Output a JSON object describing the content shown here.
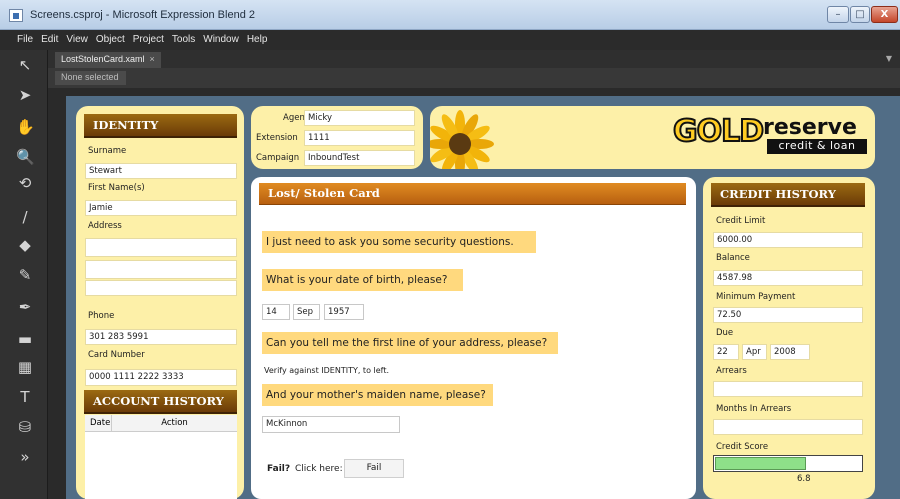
{
  "window": {
    "title": "Screens.csproj - Microsoft Expression Blend 2",
    "buttons": {
      "minimize": "–",
      "maximize": "□",
      "close": "X"
    }
  },
  "menu": [
    "File",
    "Edit",
    "View",
    "Object",
    "Project",
    "Tools",
    "Window",
    "Help"
  ],
  "document_tab": {
    "label": "LostStolenCard.xaml",
    "close": "×"
  },
  "selection_label": "None selected",
  "tools": [
    {
      "name": "selection-tool-icon",
      "glyph": "↖"
    },
    {
      "name": "direct-selection-tool-icon",
      "glyph": "➤"
    },
    {
      "name": "pan-tool-icon",
      "glyph": "✋"
    },
    {
      "name": "zoom-tool-icon",
      "glyph": "🔍"
    },
    {
      "name": "camera-orbit-tool-icon",
      "glyph": "⟲"
    },
    {
      "name": "eyedropper-tool-icon",
      "glyph": "/"
    },
    {
      "name": "paint-bucket-tool-icon",
      "glyph": "◆"
    },
    {
      "name": "pencil-tool-icon",
      "glyph": "✎"
    },
    {
      "name": "pen-tool-icon",
      "glyph": "✒"
    },
    {
      "name": "rectangle-tool-icon",
      "glyph": "▬"
    },
    {
      "name": "grid-tool-icon",
      "glyph": "▦"
    },
    {
      "name": "text-tool-icon",
      "glyph": "T"
    },
    {
      "name": "asset-tool-icon",
      "glyph": "⛁"
    },
    {
      "name": "more-tools-icon",
      "glyph": "»"
    }
  ],
  "identity": {
    "heading": "IDENTITY",
    "surname_label": "Surname",
    "surname_value": "Stewart",
    "first_names_label": "First Name(s)",
    "first_names_value": "Jamie",
    "address_label": "Address",
    "address_lines": [
      "",
      "",
      ""
    ],
    "phone_label": "Phone",
    "phone_value": "301 283 5991",
    "card_number_label": "Card Number",
    "card_number_value": "0000 1111 2222 3333"
  },
  "account_history": {
    "heading": "ACCOUNT HISTORY",
    "columns": [
      "Date",
      "Action"
    ]
  },
  "agent": {
    "agent_label": "Agent",
    "agent_value": "Micky",
    "extension_label": "Extension",
    "extension_value": "1111",
    "campaign_label": "Campaign",
    "campaign_value": "InboundTest"
  },
  "logo": {
    "gold": "GOLD",
    "reserve": "reserve",
    "tagline": "credit & loan"
  },
  "script": {
    "heading": "Lost/ Stolen Card",
    "q1": "I just need to ask you some security questions.",
    "q2": "What is your date of birth, please?",
    "dob_day": "14",
    "dob_month": "Sep",
    "dob_year": "1957",
    "q3": "Can you tell me the first line of your address, please?",
    "verify_note": "Verify against IDENTITY, to left.",
    "q4": "And your mother's maiden name, please?",
    "maiden_name": "McKinnon",
    "fail_prompt_bold": "Fail?",
    "fail_prompt_rest": "Click here:",
    "fail_button": "Fail"
  },
  "credit_history": {
    "heading": "CREDIT HISTORY",
    "credit_limit_label": "Credit Limit",
    "credit_limit_value": "6000.00",
    "balance_label": "Balance",
    "balance_value": "4587.98",
    "min_payment_label": "Minimum Payment",
    "min_payment_value": "72.50",
    "due_label": "Due",
    "due_day": "22",
    "due_month": "Apr",
    "due_year": "2008",
    "arrears_label": "Arrears",
    "arrears_value": "",
    "months_in_arrears_label": "Months In Arrears",
    "months_in_arrears_value": "",
    "credit_score_label": "Credit Score",
    "credit_score_value": "6.8",
    "credit_score_fill_fraction": 0.62
  },
  "colors": {
    "panel": "#fdf0a8",
    "question": "#ffd97e",
    "heading_dark": "#6b3b07",
    "heading_orange": "#d07a1d",
    "score_fill": "#8ee089"
  }
}
